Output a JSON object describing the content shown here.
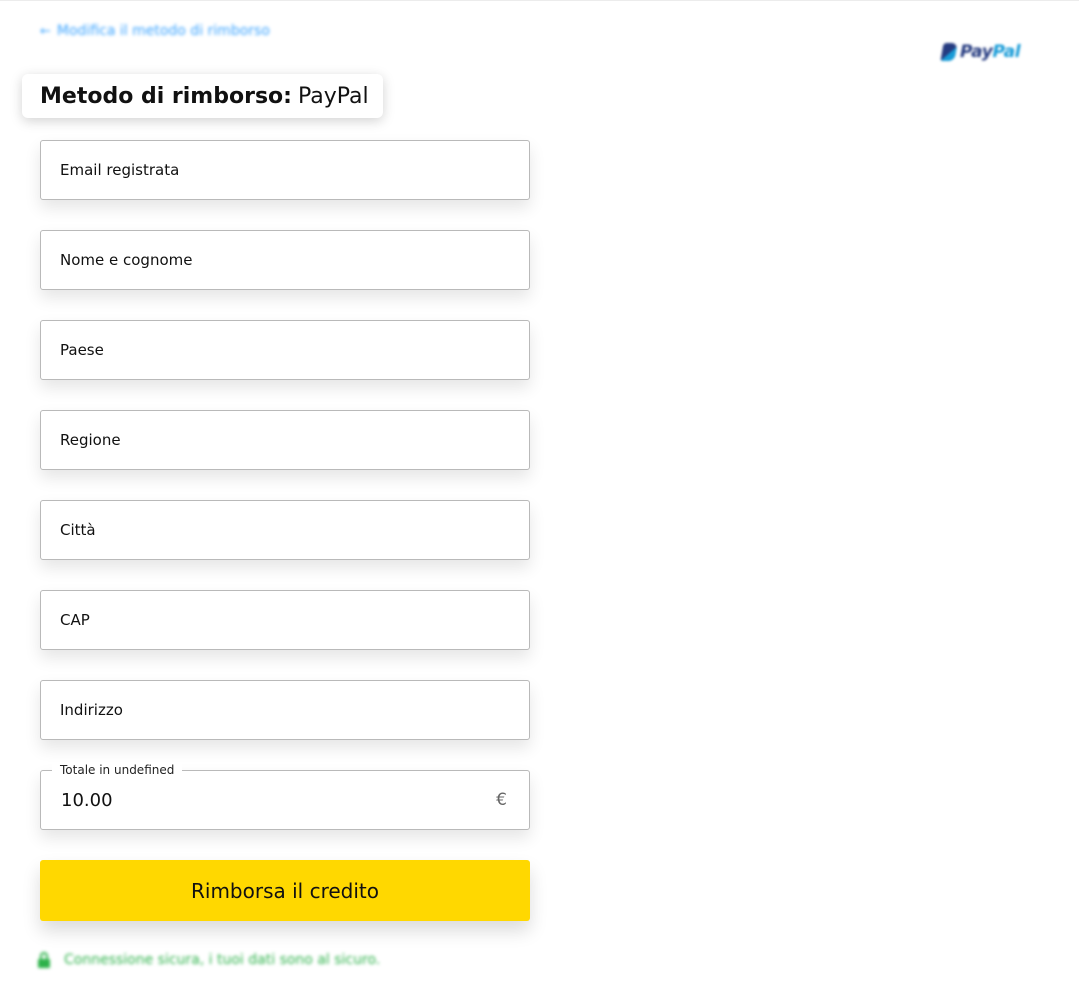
{
  "header": {
    "back_link_label": "Modifica il metodo di rimborso",
    "back_arrow_icon": "arrow-left-icon",
    "brand_logo": {
      "pay": "Pay",
      "pal": "Pal",
      "colors": {
        "dark": "#253b80",
        "light": "#179bd7"
      }
    }
  },
  "method": {
    "label": "Metodo di rimborso:",
    "value": "PayPal"
  },
  "form": {
    "fields": [
      {
        "name": "email",
        "placeholder": "Email registrata"
      },
      {
        "name": "full-name",
        "placeholder": "Nome e cognome"
      },
      {
        "name": "country",
        "placeholder": "Paese"
      },
      {
        "name": "region",
        "placeholder": "Regione"
      },
      {
        "name": "city",
        "placeholder": "Città"
      },
      {
        "name": "postal-code",
        "placeholder": "CAP"
      },
      {
        "name": "address",
        "placeholder": "Indirizzo"
      }
    ],
    "amount": {
      "legend": "Totale in undefined",
      "value": "10.00",
      "currency_symbol": "€"
    },
    "submit_label": "Rimborsa il credito"
  },
  "footer": {
    "secure_text": "Connessione sicura, i tuoi dati sono al sicuro.",
    "icon": "lock-icon"
  },
  "colors": {
    "accent_button": "#ffd800",
    "link": "#3aa3ff",
    "secure": "#2db24a"
  }
}
